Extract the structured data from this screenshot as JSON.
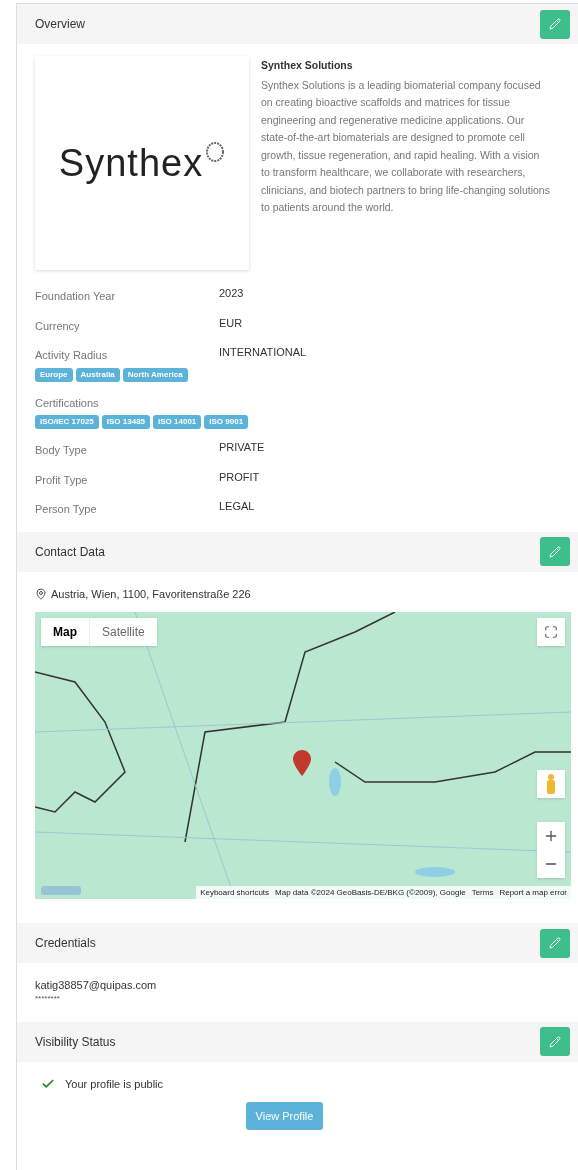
{
  "overview": {
    "title": "Overview",
    "logo_text": "Synthex",
    "company_name": "Synthex Solutions",
    "description": "Synthex Solutions is a leading biomaterial company focused on creating bioactive scaffolds and matrices for tissue engineering and regenerative medicine applications. Our state-of-the-art biomaterials are designed to promote cell growth, tissue regeneration, and rapid healing. With a vision to transform healthcare, we collaborate with researchers, clinicians, and biotech partners to bring life-changing solutions to patients around the world.",
    "fields": [
      {
        "label": "Foundation Year",
        "value": "2023"
      },
      {
        "label": "Currency",
        "value": "EUR"
      },
      {
        "label": "Activity Radius",
        "value": "INTERNATIONAL",
        "tags": [
          "Europe",
          "Australia",
          "North America"
        ]
      },
      {
        "label": "Certifications",
        "tags": [
          "ISO/IEC 17025",
          "ISO 13485",
          "ISO 14001",
          "ISO 9001"
        ]
      },
      {
        "label": "Body Type",
        "value": "PRIVATE"
      },
      {
        "label": "Profit Type",
        "value": "PROFIT"
      },
      {
        "label": "Person Type",
        "value": "LEGAL"
      }
    ]
  },
  "contact": {
    "title": "Contact Data",
    "address": "Austria, Wien, 1100, Favoritenstraße 226",
    "map": {
      "tabs": [
        {
          "label": "Map",
          "selected": true
        },
        {
          "label": "Satellite",
          "selected": false
        }
      ],
      "footer": [
        "Keyboard shortcuts",
        "Map data ©2024 GeoBasis-DE/BKG (©2009), Google",
        "Terms",
        "Report a map error"
      ]
    }
  },
  "credentials": {
    "title": "Credentials",
    "email": "katig38857@quipas.com",
    "password": "********"
  },
  "visibility": {
    "title": "Visibility Status",
    "public": true,
    "message": "Your profile is public",
    "button": "View Profile"
  }
}
